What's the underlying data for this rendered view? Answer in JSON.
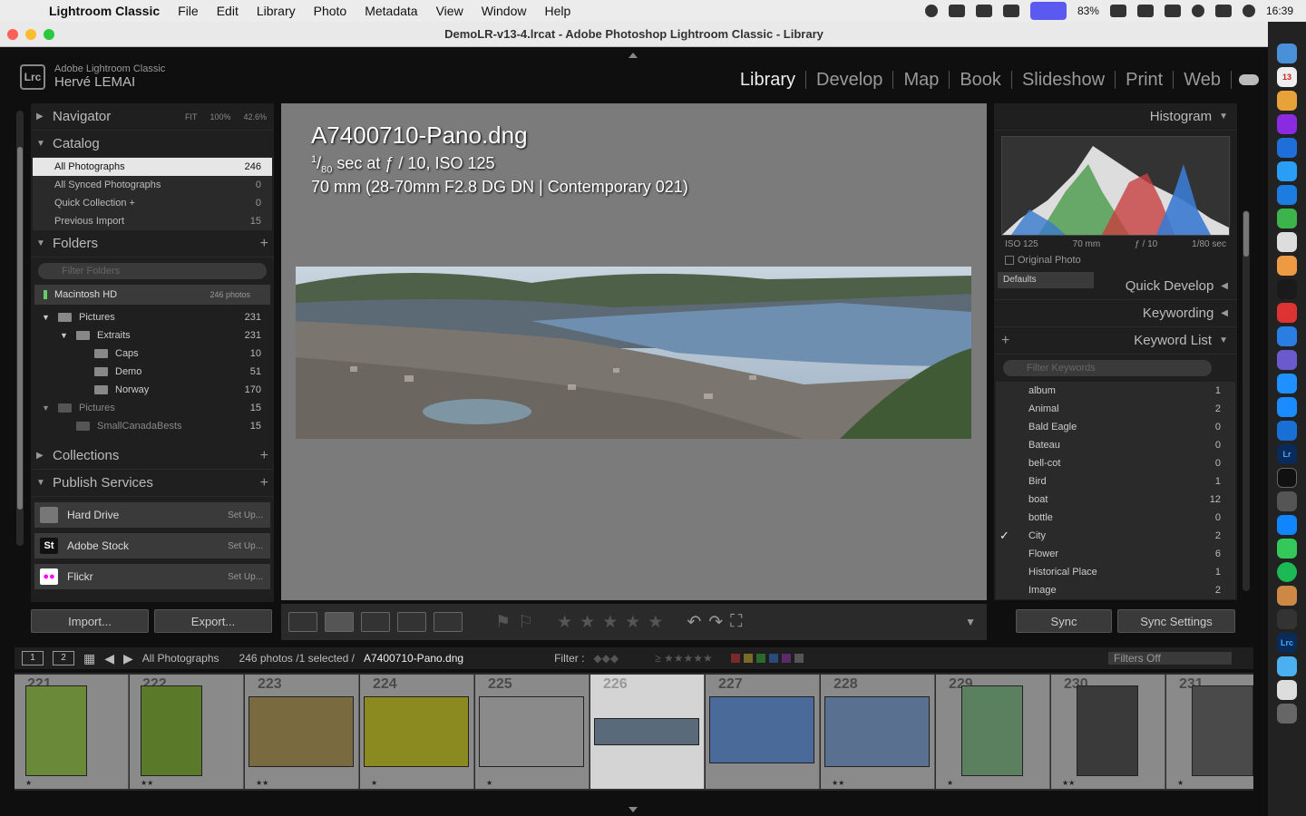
{
  "menubar": {
    "app": "Lightroom Classic",
    "items": [
      "File",
      "Edit",
      "Library",
      "Photo",
      "Metadata",
      "View",
      "Window",
      "Help"
    ],
    "battery": "83%",
    "time": "16:39"
  },
  "window": {
    "title": "DemoLR-v13-4.lrcat - Adobe Photoshop Lightroom Classic - Library"
  },
  "identity": {
    "product": "Adobe Lightroom Classic",
    "user": "Hervé LEMAI",
    "logo": "Lrc"
  },
  "modules": [
    "Library",
    "Develop",
    "Map",
    "Book",
    "Slideshow",
    "Print",
    "Web"
  ],
  "active_module": "Library",
  "left": {
    "navigator": {
      "title": "Navigator",
      "fit": "FIT",
      "z100": "100%",
      "zoom": "42.6%"
    },
    "catalog": {
      "title": "Catalog",
      "items": [
        {
          "label": "All Photographs",
          "count": "246"
        },
        {
          "label": "All Synced Photographs",
          "count": "0"
        },
        {
          "label": "Quick Collection +",
          "count": "0"
        },
        {
          "label": "Previous Import",
          "count": "15"
        }
      ]
    },
    "folders": {
      "title": "Folders",
      "filter_placeholder": "Filter Folders",
      "volume": "Macintosh HD",
      "volume_count": "246 photos",
      "tree": [
        {
          "label": "Pictures",
          "count": "231"
        },
        {
          "label": "Extraits",
          "count": "231"
        },
        {
          "label": "Caps",
          "count": "10"
        },
        {
          "label": "Demo",
          "count": "51"
        },
        {
          "label": "Norway",
          "count": "170"
        },
        {
          "label": "Pictures",
          "count": "15"
        },
        {
          "label": "SmallCanadaBests",
          "count": "15"
        }
      ]
    },
    "collections": {
      "title": "Collections"
    },
    "publish": {
      "title": "Publish Services",
      "items": [
        {
          "label": "Hard Drive",
          "action": "Set Up..."
        },
        {
          "label": "Adobe Stock",
          "action": "Set Up..."
        },
        {
          "label": "Flickr",
          "action": "Set Up..."
        }
      ]
    },
    "import": "Import...",
    "export": "Export..."
  },
  "center": {
    "filename": "A7400710-Pano.dng",
    "exposure_num": "1",
    "exposure_den": "80",
    "exposure_rest": " sec at ƒ / 10, ISO 125",
    "lens": "70 mm (28-70mm F2.8 DG DN | Contemporary 021)"
  },
  "right": {
    "histogram": {
      "title": "Histogram",
      "iso": "ISO 125",
      "focal": "70 mm",
      "aperture": "ƒ / 10",
      "shutter": "1/80 sec",
      "original": "Original Photo"
    },
    "quick_develop": {
      "title": "Quick Develop",
      "preset": "Defaults"
    },
    "keywording": {
      "title": "Keywording"
    },
    "keyword_list": {
      "title": "Keyword List",
      "filter_placeholder": "Filter Keywords",
      "items": [
        {
          "label": "album",
          "count": "1",
          "checked": false
        },
        {
          "label": "Animal",
          "count": "2",
          "checked": false
        },
        {
          "label": "Bald Eagle",
          "count": "0",
          "checked": false
        },
        {
          "label": "Bateau",
          "count": "0",
          "checked": false
        },
        {
          "label": "bell-cot",
          "count": "0",
          "checked": false
        },
        {
          "label": "Bird",
          "count": "1",
          "checked": false
        },
        {
          "label": "boat",
          "count": "12",
          "checked": false
        },
        {
          "label": "bottle",
          "count": "0",
          "checked": false
        },
        {
          "label": "City",
          "count": "2",
          "checked": true
        },
        {
          "label": "Flower",
          "count": "6",
          "checked": false
        },
        {
          "label": "Historical Place",
          "count": "1",
          "checked": false
        },
        {
          "label": "Image",
          "count": "2",
          "checked": false
        }
      ]
    },
    "sync": "Sync",
    "sync_settings": "Sync Settings"
  },
  "filmbar": {
    "source": "All Photographs",
    "status": "246 photos /1 selected /",
    "selected": "A7400710-Pano.dng",
    "filter_label": "Filter :",
    "filters_off": "Filters Off",
    "view1": "1",
    "view2": "2"
  },
  "filmstrip": [
    {
      "num": "221",
      "stars": "★",
      "color": "#6a8a3a",
      "sel": false
    },
    {
      "num": "222",
      "stars": "★★",
      "color": "#5a7a2a",
      "sel": false
    },
    {
      "num": "223",
      "stars": "★★",
      "color": "#7a6a40",
      "sel": false
    },
    {
      "num": "224",
      "stars": "★",
      "color": "#8a8a20",
      "sel": false
    },
    {
      "num": "225",
      "stars": "★",
      "color": "#8a8a8a",
      "sel": false
    },
    {
      "num": "226",
      "stars": "",
      "color": "#5a6a7a",
      "sel": true
    },
    {
      "num": "227",
      "stars": "",
      "color": "#4a6a9a",
      "sel": false
    },
    {
      "num": "228",
      "stars": "★★",
      "color": "#5a7090",
      "sel": false
    },
    {
      "num": "229",
      "stars": "★",
      "color": "#5a8060",
      "sel": false
    },
    {
      "num": "230",
      "stars": "★★",
      "color": "#3a3a3a",
      "sel": false
    },
    {
      "num": "231",
      "stars": "★",
      "color": "#4a4a4a",
      "sel": false
    }
  ],
  "colors": {
    "accent": "#5a5af0",
    "selected_row": "#e6e6e6",
    "panel": "#1f1f1f",
    "center_bg": "#7b7b7b"
  }
}
